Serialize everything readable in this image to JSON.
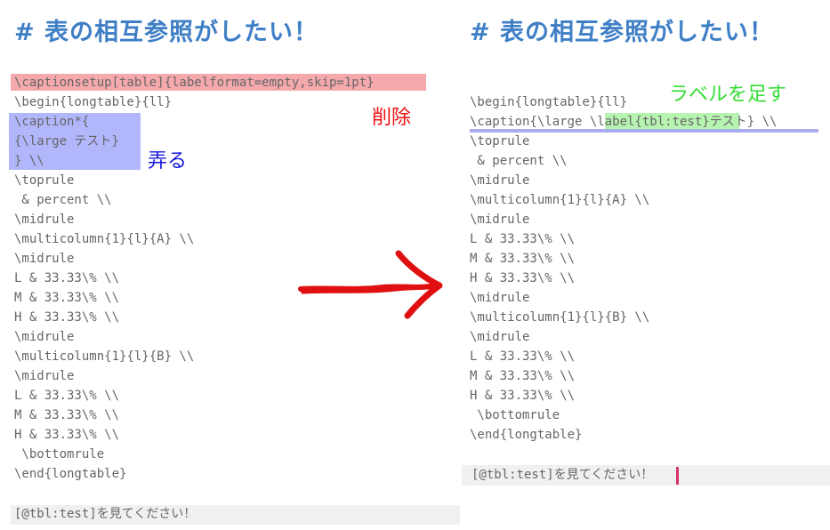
{
  "left_panel": {
    "title": "#  表の相互参照がしたい！",
    "lines": [
      "\\captionsetup[table]{labelformat=empty,skip=1pt}",
      "\\begin{longtable}{ll}",
      "\\caption*{",
      "{\\large テスト}",
      "} \\\\",
      "\\toprule",
      " & percent \\\\",
      "\\midrule",
      "\\multicolumn{1}{l}{A} \\\\",
      "\\midrule",
      "L & 33.33\\% \\\\",
      "M & 33.33\\% \\\\",
      "H & 33.33\\% \\\\",
      "\\midrule",
      "\\multicolumn{1}{l}{B} \\\\",
      "\\midrule",
      "L & 33.33\\% \\\\",
      "M & 33.33\\% \\\\",
      "H & 33.33\\% \\\\",
      " \\bottomrule",
      "\\end{longtable}"
    ],
    "annotation_delete": "削除",
    "annotation_modify": "弄る",
    "reference_text": "[@tbl:test]を見てください！"
  },
  "right_panel": {
    "title": "#  表の相互参照がしたい！",
    "line_begin": "\\begin{longtable}{ll}",
    "caption_prefix": "\\caption{\\large ",
    "caption_label": "\\label{tbl:test}",
    "caption_suffix": "テスト} \\\\",
    "lines_after": [
      "\\toprule",
      " & percent \\\\",
      "\\midrule",
      "\\multicolumn{1}{l}{A} \\\\",
      "\\midrule",
      "L & 33.33\\% \\\\",
      "M & 33.33\\% \\\\",
      "H & 33.33\\% \\\\",
      "\\midrule",
      "\\multicolumn{1}{l}{B} \\\\",
      "\\midrule",
      "L & 33.33\\% \\\\",
      "M & 33.33\\% \\\\",
      "H & 33.33\\% \\\\",
      " \\bottomrule",
      "\\end{longtable}"
    ],
    "annotation_add_label": "ラベルを足す",
    "reference_text": "[@tbl:test]を見てください！"
  },
  "colors": {
    "heading": "#3f7fc6",
    "delete_highlight": "#f5a9ad",
    "modify_highlight": "#b2b6fb",
    "label_highlight": "#b7f3b1",
    "delete_text": "#ee1111",
    "modify_text": "#1515dd",
    "add_label_text": "#33dd33",
    "arrow": "#e01010",
    "cursor": "#d6336c"
  },
  "icons": {
    "arrow": "arrow-right-icon"
  }
}
